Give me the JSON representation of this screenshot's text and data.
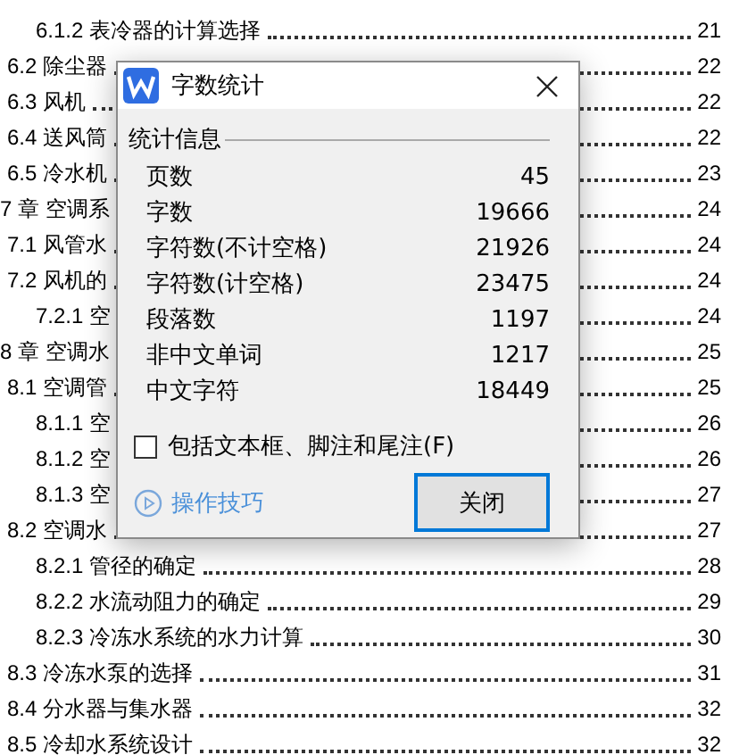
{
  "toc": [
    {
      "kind": "subsection",
      "text": "6.1.2 表冷器的计算选择",
      "page": "21"
    },
    {
      "kind": "section",
      "text": "6.2 除尘器",
      "page": "22"
    },
    {
      "kind": "section",
      "text": "6.3 风机",
      "page": "22"
    },
    {
      "kind": "section",
      "text": "6.4 送风筒",
      "page": "22"
    },
    {
      "kind": "section",
      "text": "6.5 冷水机",
      "page": "23"
    },
    {
      "kind": "chapter",
      "text": "7 章 空调系",
      "page": "24",
      "children": [
        {
          "kind": "section",
          "text": "7.1 风管水",
          "page": "24"
        },
        {
          "kind": "section",
          "text": "7.2 风机的",
          "page": "24",
          "children": [
            {
              "kind": "subsection",
              "text": "7.2.1 空",
              "page": "24"
            }
          ]
        }
      ]
    },
    {
      "kind": "chapter",
      "text": "8 章 空调水",
      "page": "25",
      "children": [
        {
          "kind": "section",
          "text": "8.1 空调管",
          "page": "25",
          "children": [
            {
              "kind": "subsection",
              "text": "8.1.1 空",
              "page": "26"
            },
            {
              "kind": "subsection",
              "text": "8.1.2 空",
              "page": "26"
            },
            {
              "kind": "subsection",
              "text": "8.1.3 空",
              "page": "27"
            }
          ]
        },
        {
          "kind": "section",
          "text": "8.2 空调水",
          "page": "27",
          "children": [
            {
              "kind": "subsection",
              "text": "8.2.1 管径的确定",
              "page": "28"
            },
            {
              "kind": "subsection",
              "text": "8.2.2 水流动阻力的确定",
              "page": "29"
            },
            {
              "kind": "subsection",
              "text": "8.2.3 冷冻水系统的水力计算",
              "page": "30"
            }
          ]
        },
        {
          "kind": "section",
          "text": "8.3 冷冻水泵的选择",
          "page": "31"
        },
        {
          "kind": "section",
          "text": "8.4 分水器与集水器",
          "page": "32"
        },
        {
          "kind": "section",
          "text": "8.5 冷却水系统设计",
          "page": "32"
        }
      ]
    }
  ],
  "dialog": {
    "title": "字数统计",
    "group_label": "统计信息",
    "stats": [
      {
        "label": "页数",
        "value": "45"
      },
      {
        "label": "字数",
        "value": "19666"
      },
      {
        "label": "字符数(不计空格)",
        "value": "21926"
      },
      {
        "label": "字符数(计空格)",
        "value": "23475"
      },
      {
        "label": "段落数",
        "value": "1197"
      },
      {
        "label": "非中文单词",
        "value": "1217"
      },
      {
        "label": "中文字符",
        "value": "18449"
      }
    ],
    "include_option": {
      "label": "包括文本框、脚注和尾注(F)",
      "checked": false
    },
    "tips_link": "操作技巧",
    "close_button": "关闭"
  }
}
